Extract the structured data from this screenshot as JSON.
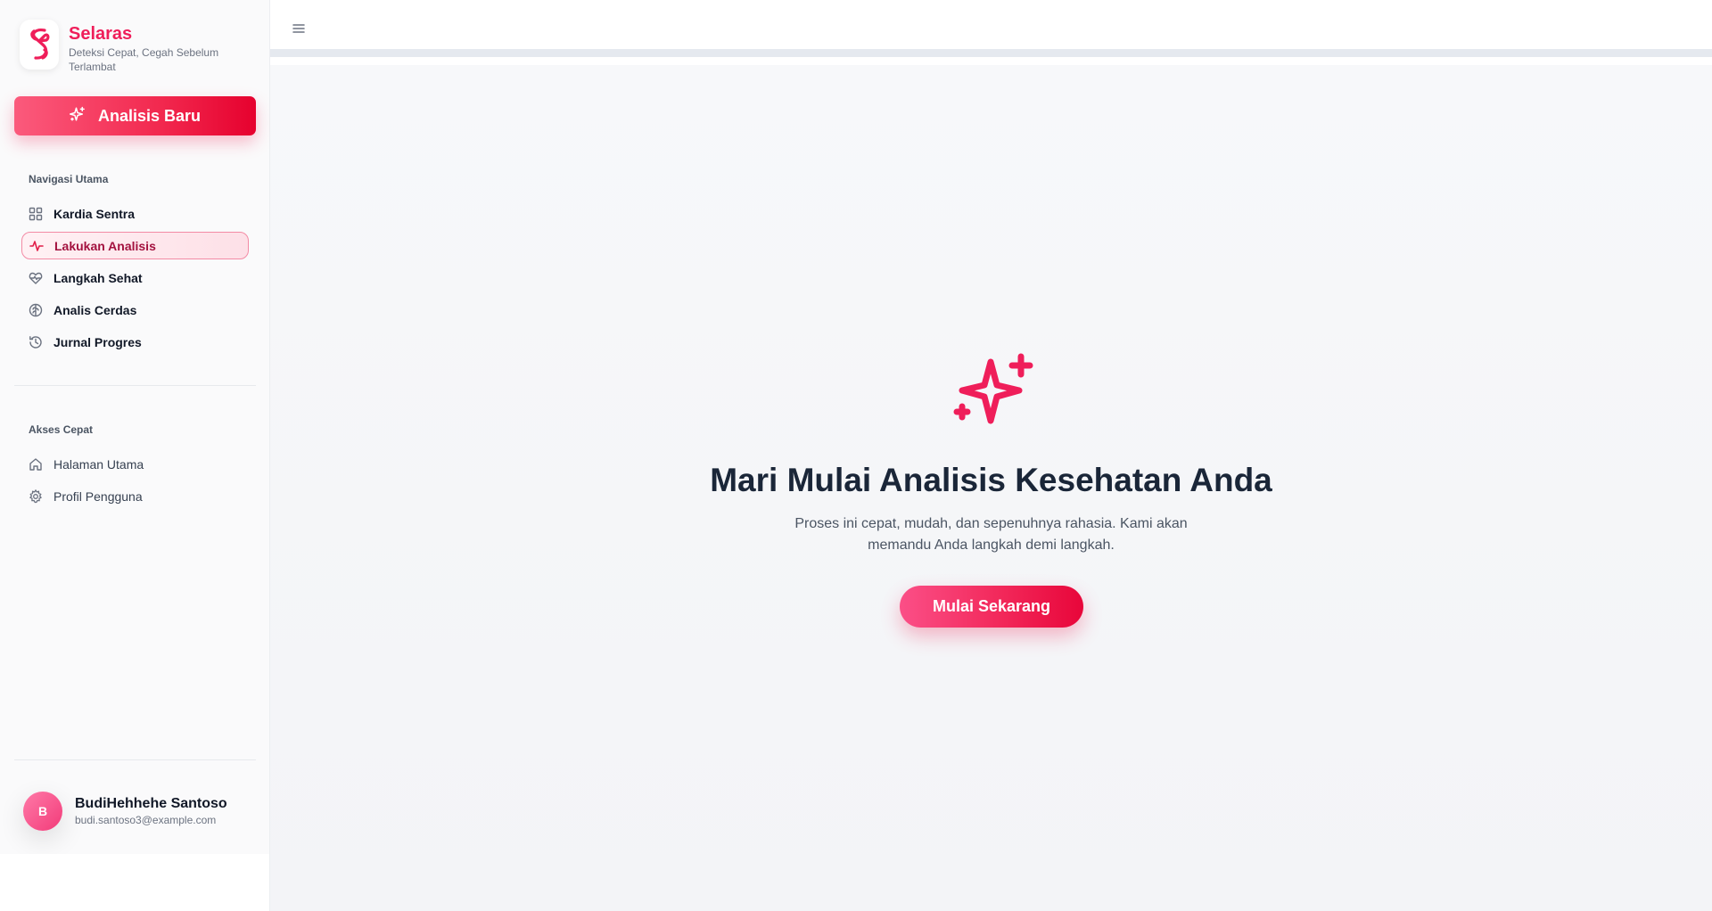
{
  "brand": {
    "title": "Selaras",
    "tagline": "Deteksi Cepat, Cegah Sebelum Terlambat",
    "logo_icon": "double-s-heart-logo",
    "color": "#ef1e5a"
  },
  "new_analysis_button": {
    "label": "Analisis Baru",
    "icon": "sparkle-icon"
  },
  "nav": {
    "section_title": "Navigasi Utama",
    "items": [
      {
        "label": "Kardia Sentra",
        "icon": "grid-icon",
        "active": false
      },
      {
        "label": "Lakukan Analisis",
        "icon": "pulse-icon",
        "active": true
      },
      {
        "label": "Langkah Sehat",
        "icon": "heart-pulse-icon",
        "active": false
      },
      {
        "label": "Analis Cerdas",
        "icon": "brain-icon",
        "active": false
      },
      {
        "label": "Jurnal Progres",
        "icon": "history-icon",
        "active": false
      }
    ]
  },
  "quick_access": {
    "section_title": "Akses Cepat",
    "items": [
      {
        "label": "Halaman Utama",
        "icon": "home-icon"
      },
      {
        "label": "Profil Pengguna",
        "icon": "gear-icon"
      }
    ]
  },
  "user": {
    "initial": "B",
    "name": "BudiHehhehe Santoso",
    "email": "budi.santoso3@example.com"
  },
  "topbar": {
    "menu_icon": "hamburger-icon"
  },
  "hero": {
    "icon": "sparkles-icon",
    "title": "Mari Mulai Analisis Kesehatan Anda",
    "subtitle": "Proses ini cepat, mudah, dan sepenuhnya rahasia. Kami akan memandu Anda langkah demi langkah.",
    "cta_label": "Mulai Sekarang"
  },
  "colors": {
    "accent": "#ef1e5a",
    "active_text": "#a3123f",
    "title_text": "#1a2638"
  }
}
